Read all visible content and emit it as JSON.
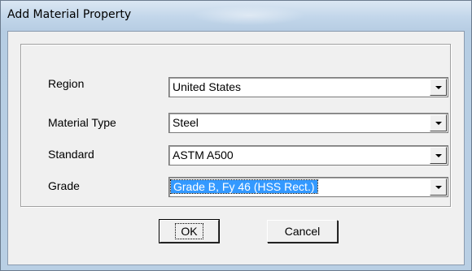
{
  "window": {
    "title": "Add Material Property"
  },
  "form": {
    "fields": [
      {
        "label": "Region",
        "value": "United States"
      },
      {
        "label": "Material Type",
        "value": "Steel"
      },
      {
        "label": "Standard",
        "value": "ASTM A500"
      },
      {
        "label": "Grade",
        "value": "Grade B, Fy 46 (HSS Rect.)"
      }
    ]
  },
  "buttons": {
    "ok": "OK",
    "cancel": "Cancel"
  },
  "colors": {
    "selection": "#3399ff",
    "titlebar": "#c2d6ea",
    "dialog_face": "#f0f0f0"
  },
  "icons": {
    "dropdown": "chevron-down-icon"
  }
}
